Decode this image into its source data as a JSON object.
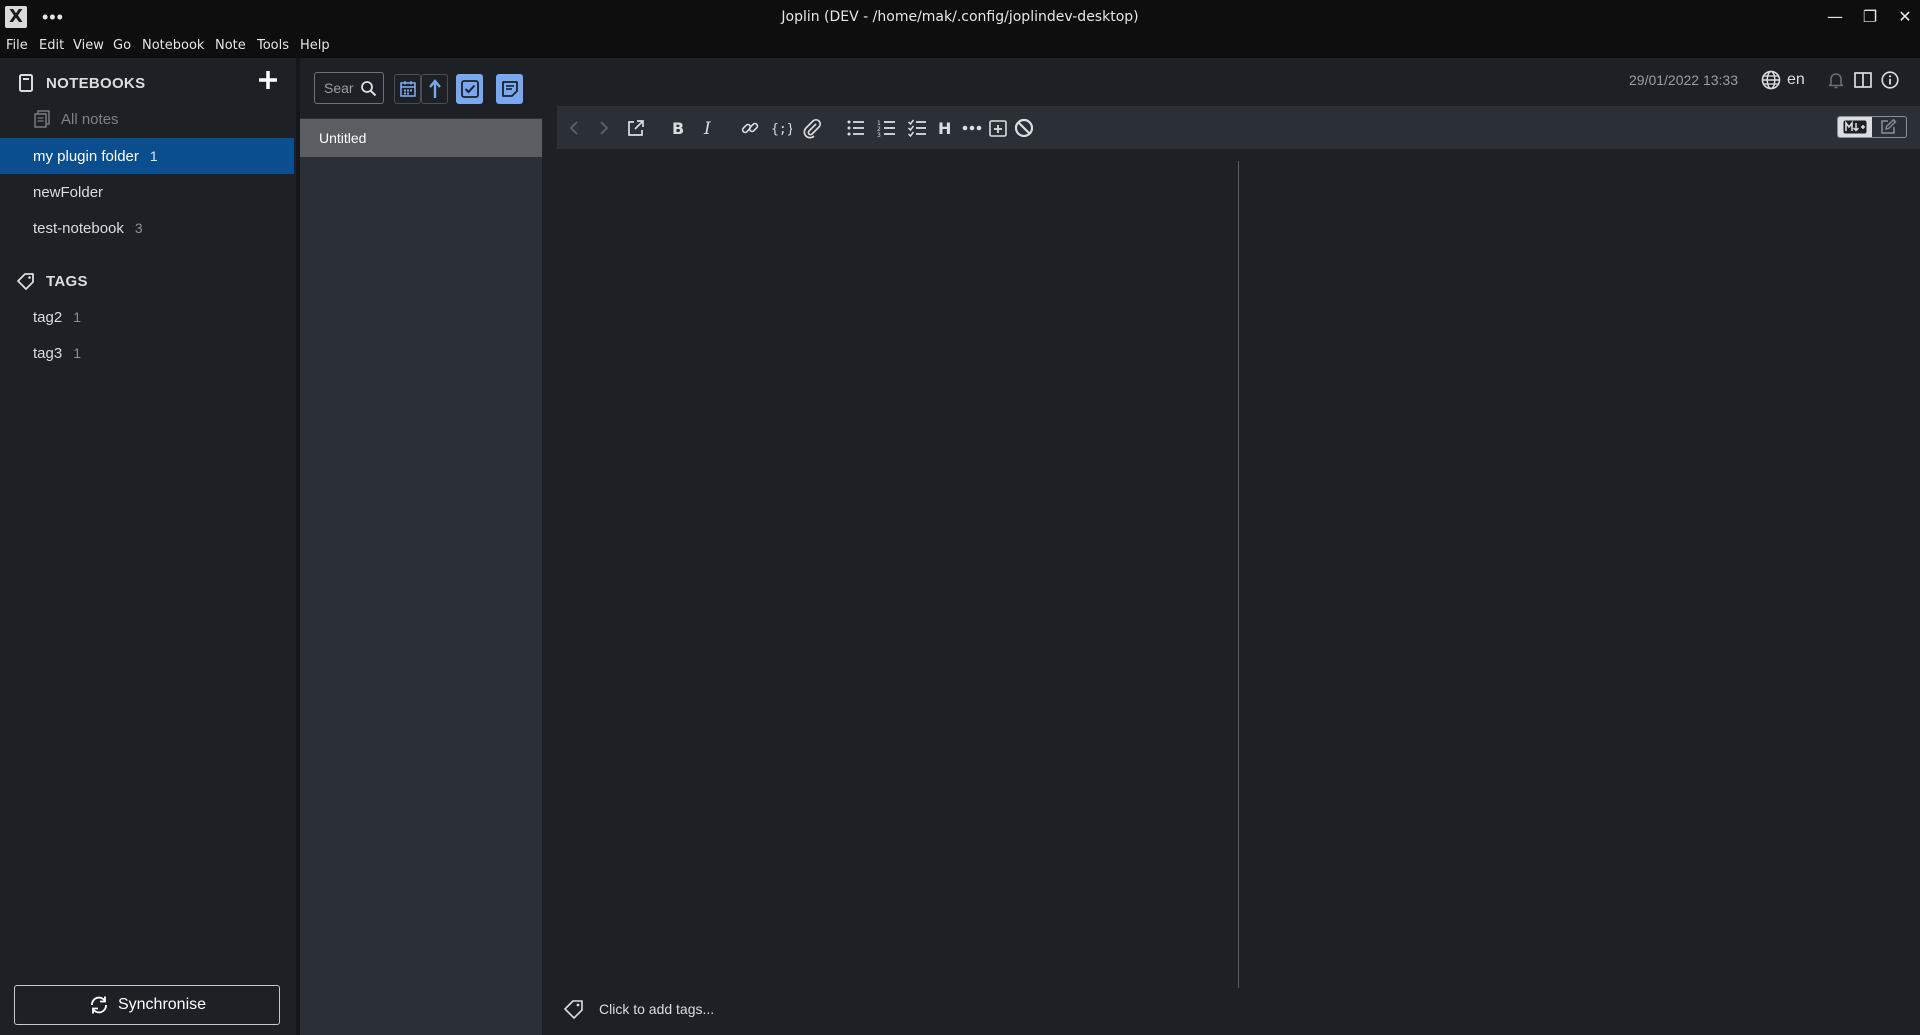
{
  "window": {
    "title": "Joplin (DEV - /home/mak/.config/joplindev-desktop)",
    "app_icon_glyph": "X",
    "more_glyph": "•••",
    "minimize_glyph": "—",
    "maximize_glyph": "❐",
    "close_glyph": "✕"
  },
  "menu": [
    "File",
    "Edit",
    "View",
    "Go",
    "Notebook",
    "Note",
    "Tools",
    "Help"
  ],
  "sidebar": {
    "notebooks_header": "NOTEBOOKS",
    "all_notes": "All notes",
    "folders": [
      {
        "label": "my plugin folder",
        "count": "1",
        "selected": true
      },
      {
        "label": "newFolder",
        "count": ""
      },
      {
        "label": "test-notebook",
        "count": "3"
      }
    ],
    "tags_header": "TAGS",
    "tags": [
      {
        "label": "tag2",
        "count": "1"
      },
      {
        "label": "tag3",
        "count": "1"
      }
    ],
    "sync_label": "Synchronise"
  },
  "note_list": {
    "search_placeholder": "Search...",
    "search_value": "Sear",
    "notes": [
      {
        "title": "Untitled",
        "selected": true
      }
    ]
  },
  "editor": {
    "date": "29/01/2022 13:33",
    "language": "en",
    "tags_placeholder": "Click to add tags...",
    "toolbar_icons": [
      "back-icon",
      "forward-icon",
      "external-edit-icon",
      "bold-icon",
      "italic-icon",
      "link-icon",
      "code-icon",
      "attachment-icon",
      "bulleted-list-icon",
      "numbered-list-icon",
      "checkbox-list-icon",
      "heading-icon",
      "horizontal-rule-icon",
      "insert-datetime-icon",
      "spellcheck-disable-icon"
    ]
  },
  "colors": {
    "accent_selected": "#0b4e8f",
    "toggle_active": "#7aa8f0",
    "background": "#1d2024",
    "panel": "#2b3036"
  }
}
